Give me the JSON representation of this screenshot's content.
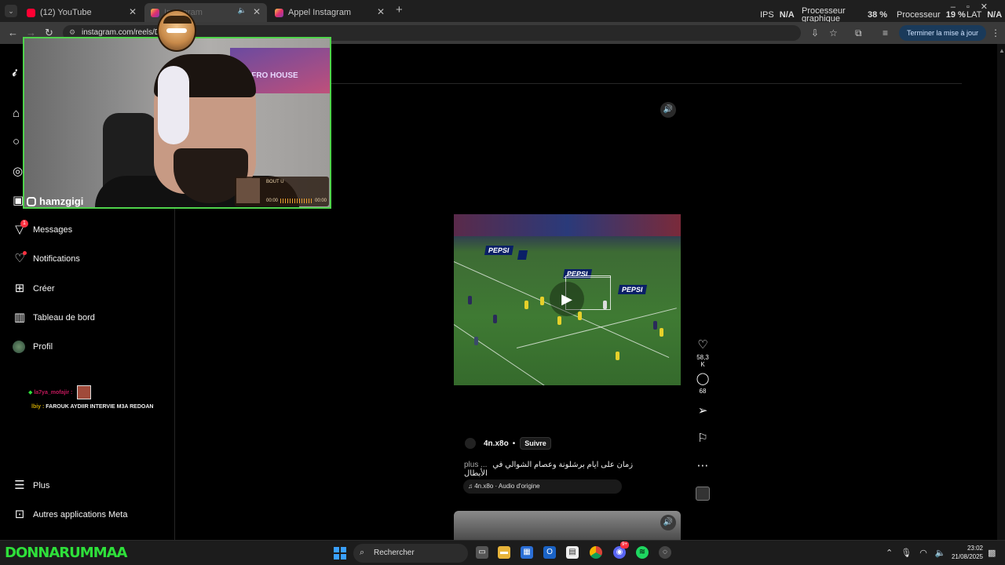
{
  "browser": {
    "tabs": [
      {
        "title": "(12) YouTube",
        "close": "✕"
      },
      {
        "title": "Instagram",
        "close": "✕",
        "audio": "🔈"
      },
      {
        "title": "Appel Instagram",
        "close": "✕"
      }
    ],
    "new_tab": "+",
    "tab_menu": "⌄",
    "url": "instagram.com/reels/D",
    "update_button": "Terminer la mise à jour",
    "profile_initial": "H"
  },
  "perf_overlay": {
    "ips_label": "IPS",
    "ips_value": "N/A",
    "gpu_label_1": "Processeur",
    "gpu_label_2": "graphique",
    "gpu_value": "38 %",
    "cpu_label": "Processeur",
    "cpu_value": "19 %",
    "lat_label": "LAT",
    "lat_value": "N/A"
  },
  "sidebar": {
    "items": [
      {
        "label": "Messages",
        "badge": "1"
      },
      {
        "label": "Notifications"
      },
      {
        "label": "Créer"
      },
      {
        "label": "Tableau de bord"
      },
      {
        "label": "Profil"
      }
    ],
    "bottom_items": [
      {
        "label": "Plus"
      },
      {
        "label": "Autres applications Meta"
      }
    ],
    "chat": {
      "user1": "la7ya_mofajir :",
      "user2": "lbiy :",
      "message": "FAROUK AYDIIR INTERVIE M3A REDOAN"
    }
  },
  "webcam": {
    "handle": "hamzgigi",
    "tv_text": "AFRO HOUSE",
    "song_title": "BOUT U",
    "time_start": "00:00",
    "time_end": "00:00"
  },
  "reel": {
    "likes": "58,3 K",
    "comments": "68",
    "author": "4n.x8o",
    "separator": "•",
    "follow": "Suivre",
    "caption_more": "plus ...",
    "caption": "زمان على ايام برشلونة وعصام الشوالي في الأبطال",
    "audio": "4n.x8o · Audio d'origine",
    "ad_text": "PEPSI"
  },
  "taskbar": {
    "logo_text": "DONNARUMMAA",
    "search_placeholder": "Rechercher",
    "time": "23:02",
    "date": "21/08/2025",
    "chat_badge": "9+"
  },
  "colors": {
    "accent_green": "#4fd34b",
    "notification_red": "#ff3040",
    "update_blue": "#1a3a5a"
  }
}
